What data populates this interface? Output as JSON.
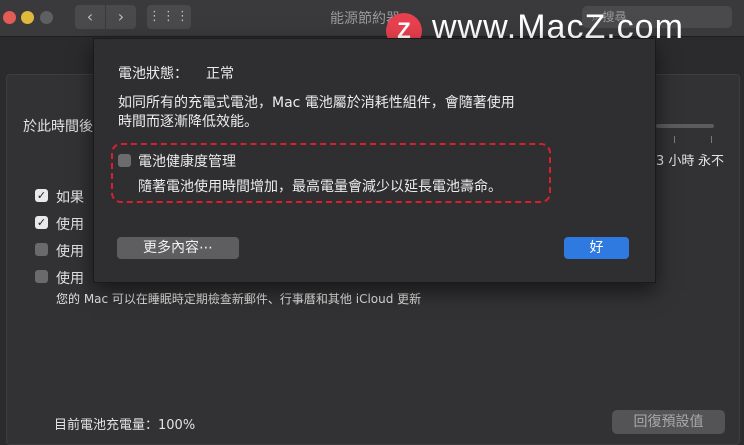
{
  "window": {
    "title": "能源節約器",
    "nav_back": "‹",
    "nav_forward": "›",
    "grid_button": "⋮⋮⋮",
    "search_placeholder": "搜尋"
  },
  "watermark": {
    "badge": "Z",
    "text": "www.MacZ.com"
  },
  "background": {
    "section_label": "於此時間後",
    "checkboxes": [
      {
        "label": "如果",
        "checked": true
      },
      {
        "label": "使用",
        "checked": true
      },
      {
        "label": "使用",
        "checked": false
      },
      {
        "label": "使用",
        "checked": false
      }
    ],
    "wake_note": "您的 Mac 可以在睡眠時定期檢查新郵件、行事曆和其他 iCloud 更新",
    "slider_labels": [
      "3 小時",
      "永不"
    ],
    "battery_charge": "目前電池充電量：100%",
    "restore_defaults": "回復預設值"
  },
  "dialog": {
    "status_label": "電池狀態：",
    "status_value": "正常",
    "description_line1": "如同所有的充電式電池，Mac 電池屬於消耗性組件，會隨著使用",
    "description_line2": "時間而逐漸降低效能。",
    "health_management_label": "電池健康度管理",
    "health_management_checked": false,
    "health_management_desc": "隨著電池使用時間增加，最高電量會減少以延長電池壽命。",
    "more_info_button": "更多內容⋯",
    "ok_button": "好"
  },
  "colors": {
    "accent": "#2f7ae0",
    "highlight": "#d8202d"
  }
}
